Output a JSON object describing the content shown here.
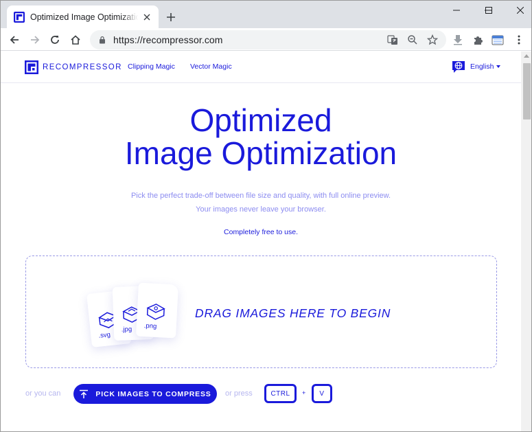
{
  "browser": {
    "tab_title": "Optimized Image Optimization",
    "url": "https://recompressor.com"
  },
  "header": {
    "brand": "RECOMPRESSOR",
    "nav": [
      "Clipping Magic",
      "Vector Magic"
    ],
    "language": "English"
  },
  "hero": {
    "title_line1": "Optimized",
    "title_line2": "Image Optimization",
    "subtitle_line1": "Pick the perfect trade-off between file size and quality, with full online preview.",
    "subtitle_line2": "Your images never leave your browser.",
    "free_note": "Completely free to use."
  },
  "dropzone": {
    "text": "DRAG IMAGES HERE TO BEGIN",
    "file_types": [
      ".svg",
      ".jpg",
      ".png"
    ]
  },
  "actions": {
    "or_you_can": "or you can",
    "pick_button": "PICK IMAGES TO COMPRESS",
    "or_press": "or press",
    "key1": "CTRL",
    "plus": "+",
    "key2": "V"
  },
  "colors": {
    "brand": "#1a1adb",
    "muted": "#8c8cf0"
  }
}
